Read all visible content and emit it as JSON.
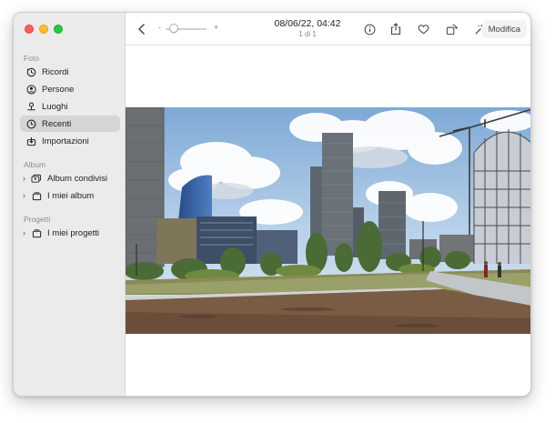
{
  "sidebar": {
    "sections": [
      {
        "title": "Foto"
      },
      {
        "title": "Album"
      },
      {
        "title": "Progetti"
      }
    ],
    "items": [
      {
        "label": "Ricordi",
        "icon": "memories-icon"
      },
      {
        "label": "Persone",
        "icon": "person-icon"
      },
      {
        "label": "Luoghi",
        "icon": "map-pin-icon"
      },
      {
        "label": "Recenti",
        "icon": "clock-icon",
        "selected": true
      },
      {
        "label": "Importazioni",
        "icon": "import-icon"
      },
      {
        "label": "Album condivisi",
        "icon": "shared-album-icon"
      },
      {
        "label": "I miei album",
        "icon": "album-icon"
      },
      {
        "label": "I miei progetti",
        "icon": "project-icon"
      }
    ]
  },
  "toolbar": {
    "zoom_minus": "-",
    "zoom_plus": "+",
    "zoom_level": 0.1,
    "date": "08/06/22, 04:42",
    "count": "1 di 1",
    "edit_label": "Modifica"
  },
  "photo": {
    "description_icon": "photo-image"
  }
}
